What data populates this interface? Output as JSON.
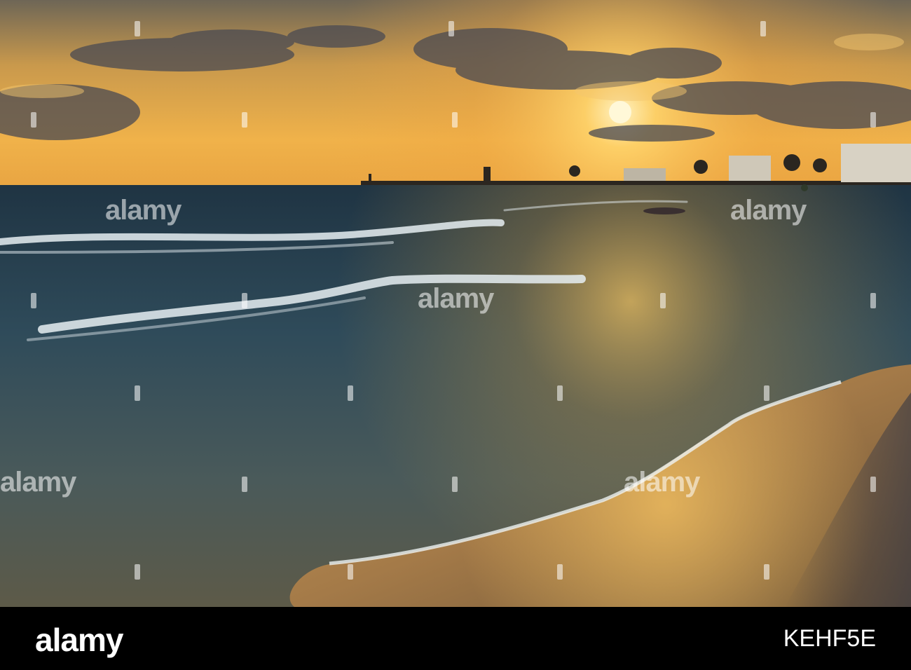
{
  "scene": {
    "description_colors": {
      "sky_top": "#7a6a52",
      "sky_glow": "#f2b64a",
      "sun": "#fff6cf",
      "sea_dark": "#243a48",
      "sea_mid": "#3f5866",
      "foam": "#e8eef0",
      "sand": "#b08a56"
    }
  },
  "watermark": {
    "text": "alamy"
  },
  "footer": {
    "logo": "alamy",
    "image_id": "KEHF5E"
  }
}
